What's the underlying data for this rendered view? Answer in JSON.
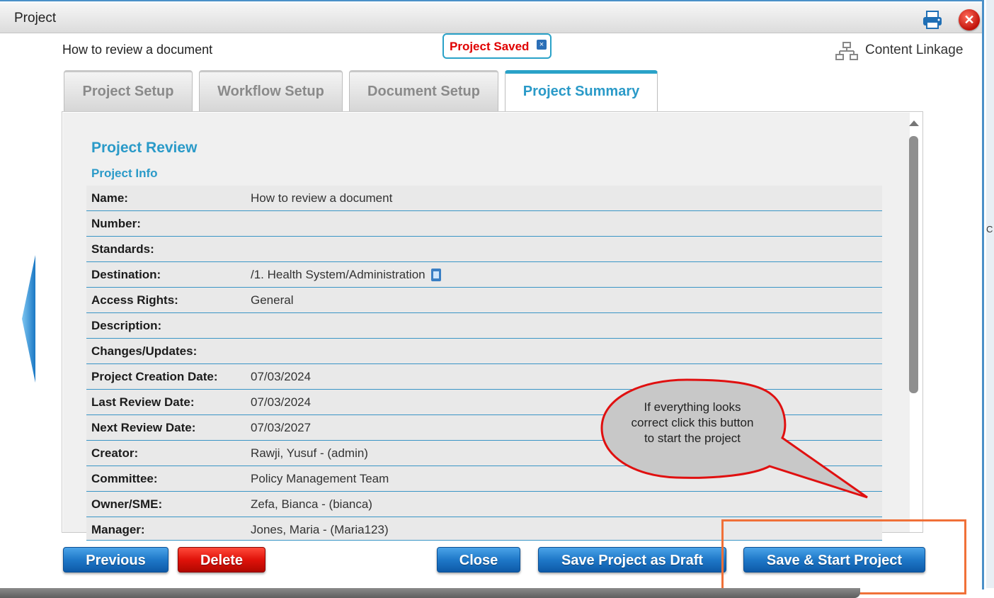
{
  "window": {
    "title": "Project"
  },
  "header": {
    "doc_title": "How to review a document",
    "saved_badge": "Project Saved",
    "content_linkage": "Content Linkage"
  },
  "tabs": [
    {
      "label": "Project Setup",
      "active": false
    },
    {
      "label": "Workflow Setup",
      "active": false
    },
    {
      "label": "Document Setup",
      "active": false
    },
    {
      "label": "Project Summary",
      "active": true
    }
  ],
  "summary": {
    "section_title": "Project Review",
    "sub_title": "Project Info",
    "rows": [
      {
        "label": "Name:",
        "value": "How to review a document"
      },
      {
        "label": "Number:",
        "value": ""
      },
      {
        "label": "Standards:",
        "value": ""
      },
      {
        "label": "Destination:",
        "value": "/1. Health System/Administration"
      },
      {
        "label": "Access Rights:",
        "value": "General"
      },
      {
        "label": "Description:",
        "value": ""
      },
      {
        "label": "Changes/Updates:",
        "value": ""
      },
      {
        "label": "Project Creation Date:",
        "value": "07/03/2024"
      },
      {
        "label": "Last Review Date:",
        "value": "07/03/2024"
      },
      {
        "label": "Next Review Date:",
        "value": "07/03/2027"
      },
      {
        "label": "Creator:",
        "value": "Rawji, Yusuf - (admin)"
      },
      {
        "label": "Committee:",
        "value": "Policy Management Team"
      },
      {
        "label": "Owner/SME:",
        "value": "Zefa, Bianca - (bianca)"
      },
      {
        "label": "Manager:",
        "value": "Jones, Maria - (Maria123)"
      }
    ]
  },
  "buttons": {
    "previous": "Previous",
    "delete": "Delete",
    "close": "Close",
    "save_draft": "Save Project as Draft",
    "save_start": "Save & Start Project"
  },
  "callout": {
    "text": "If everything looks correct click this button to start the project"
  },
  "colors": {
    "accent": "#2a9ac8",
    "saved_text": "#e00000",
    "highlight": "#f07038",
    "callout_border": "#e01010"
  }
}
